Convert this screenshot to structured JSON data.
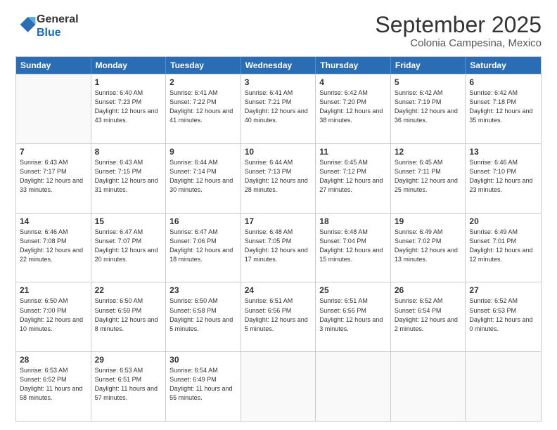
{
  "logo": {
    "general": "General",
    "blue": "Blue"
  },
  "header": {
    "month": "September 2025",
    "location": "Colonia Campesina, Mexico"
  },
  "days": [
    "Sunday",
    "Monday",
    "Tuesday",
    "Wednesday",
    "Thursday",
    "Friday",
    "Saturday"
  ],
  "weeks": [
    [
      {
        "date": "",
        "info": ""
      },
      {
        "date": "1",
        "info": "Sunrise: 6:40 AM\nSunset: 7:23 PM\nDaylight: 12 hours\nand 43 minutes."
      },
      {
        "date": "2",
        "info": "Sunrise: 6:41 AM\nSunset: 7:22 PM\nDaylight: 12 hours\nand 41 minutes."
      },
      {
        "date": "3",
        "info": "Sunrise: 6:41 AM\nSunset: 7:21 PM\nDaylight: 12 hours\nand 40 minutes."
      },
      {
        "date": "4",
        "info": "Sunrise: 6:42 AM\nSunset: 7:20 PM\nDaylight: 12 hours\nand 38 minutes."
      },
      {
        "date": "5",
        "info": "Sunrise: 6:42 AM\nSunset: 7:19 PM\nDaylight: 12 hours\nand 36 minutes."
      },
      {
        "date": "6",
        "info": "Sunrise: 6:42 AM\nSunset: 7:18 PM\nDaylight: 12 hours\nand 35 minutes."
      }
    ],
    [
      {
        "date": "7",
        "info": "Sunrise: 6:43 AM\nSunset: 7:17 PM\nDaylight: 12 hours\nand 33 minutes."
      },
      {
        "date": "8",
        "info": "Sunrise: 6:43 AM\nSunset: 7:15 PM\nDaylight: 12 hours\nand 31 minutes."
      },
      {
        "date": "9",
        "info": "Sunrise: 6:44 AM\nSunset: 7:14 PM\nDaylight: 12 hours\nand 30 minutes."
      },
      {
        "date": "10",
        "info": "Sunrise: 6:44 AM\nSunset: 7:13 PM\nDaylight: 12 hours\nand 28 minutes."
      },
      {
        "date": "11",
        "info": "Sunrise: 6:45 AM\nSunset: 7:12 PM\nDaylight: 12 hours\nand 27 minutes."
      },
      {
        "date": "12",
        "info": "Sunrise: 6:45 AM\nSunset: 7:11 PM\nDaylight: 12 hours\nand 25 minutes."
      },
      {
        "date": "13",
        "info": "Sunrise: 6:46 AM\nSunset: 7:10 PM\nDaylight: 12 hours\nand 23 minutes."
      }
    ],
    [
      {
        "date": "14",
        "info": "Sunrise: 6:46 AM\nSunset: 7:08 PM\nDaylight: 12 hours\nand 22 minutes."
      },
      {
        "date": "15",
        "info": "Sunrise: 6:47 AM\nSunset: 7:07 PM\nDaylight: 12 hours\nand 20 minutes."
      },
      {
        "date": "16",
        "info": "Sunrise: 6:47 AM\nSunset: 7:06 PM\nDaylight: 12 hours\nand 18 minutes."
      },
      {
        "date": "17",
        "info": "Sunrise: 6:48 AM\nSunset: 7:05 PM\nDaylight: 12 hours\nand 17 minutes."
      },
      {
        "date": "18",
        "info": "Sunrise: 6:48 AM\nSunset: 7:04 PM\nDaylight: 12 hours\nand 15 minutes."
      },
      {
        "date": "19",
        "info": "Sunrise: 6:49 AM\nSunset: 7:02 PM\nDaylight: 12 hours\nand 13 minutes."
      },
      {
        "date": "20",
        "info": "Sunrise: 6:49 AM\nSunset: 7:01 PM\nDaylight: 12 hours\nand 12 minutes."
      }
    ],
    [
      {
        "date": "21",
        "info": "Sunrise: 6:50 AM\nSunset: 7:00 PM\nDaylight: 12 hours\nand 10 minutes."
      },
      {
        "date": "22",
        "info": "Sunrise: 6:50 AM\nSunset: 6:59 PM\nDaylight: 12 hours\nand 8 minutes."
      },
      {
        "date": "23",
        "info": "Sunrise: 6:50 AM\nSunset: 6:58 PM\nDaylight: 12 hours\nand 5 minutes."
      },
      {
        "date": "24",
        "info": "Sunrise: 6:51 AM\nSunset: 6:56 PM\nDaylight: 12 hours\nand 5 minutes."
      },
      {
        "date": "25",
        "info": "Sunrise: 6:51 AM\nSunset: 6:55 PM\nDaylight: 12 hours\nand 3 minutes."
      },
      {
        "date": "26",
        "info": "Sunrise: 6:52 AM\nSunset: 6:54 PM\nDaylight: 12 hours\nand 2 minutes."
      },
      {
        "date": "27",
        "info": "Sunrise: 6:52 AM\nSunset: 6:53 PM\nDaylight: 12 hours\nand 0 minutes."
      }
    ],
    [
      {
        "date": "28",
        "info": "Sunrise: 6:53 AM\nSunset: 6:52 PM\nDaylight: 11 hours\nand 58 minutes."
      },
      {
        "date": "29",
        "info": "Sunrise: 6:53 AM\nSunset: 6:51 PM\nDaylight: 11 hours\nand 57 minutes."
      },
      {
        "date": "30",
        "info": "Sunrise: 6:54 AM\nSunset: 6:49 PM\nDaylight: 11 hours\nand 55 minutes."
      },
      {
        "date": "",
        "info": ""
      },
      {
        "date": "",
        "info": ""
      },
      {
        "date": "",
        "info": ""
      },
      {
        "date": "",
        "info": ""
      }
    ]
  ]
}
